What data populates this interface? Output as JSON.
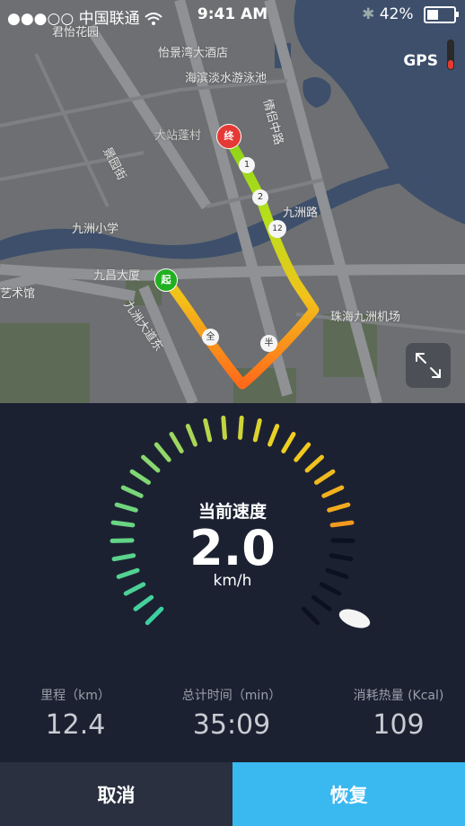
{
  "status_bar": {
    "carrier": "●●●○○ 中国联通",
    "time": "9:41 AM",
    "battery": "42%"
  },
  "map": {
    "gps_label": "GPS",
    "labels": [
      "君怡花园",
      "怡景湾大酒店",
      "海滨淡水游泳池",
      "情侣中路",
      "大站蓬村",
      "景园街",
      "九洲小学",
      "九洲路",
      "九昌大厦",
      "艺术馆",
      "九洲大道东",
      "珠海九洲机场"
    ],
    "route_markers": {
      "start": "起",
      "end": "终",
      "km1": "1",
      "km2": "2",
      "km12": "12",
      "half": "半",
      "full": "全"
    }
  },
  "gauge": {
    "title": "当前速度",
    "speed": "2.0",
    "unit": "km/h"
  },
  "stats": [
    {
      "label": "里程（km）",
      "value": "12.4"
    },
    {
      "label": "总计时间（min）",
      "value": "35:09"
    },
    {
      "label": "消耗热量 (Kcal)",
      "value": "109"
    }
  ],
  "buttons": {
    "cancel": "取消",
    "restore": "恢复"
  },
  "colors": {
    "restore_button": "#3ab8f0",
    "cancel_button": "#2a3040",
    "dashboard_bg": "#1c2132",
    "end_marker": "#e53935",
    "start_marker": "#22b022"
  }
}
